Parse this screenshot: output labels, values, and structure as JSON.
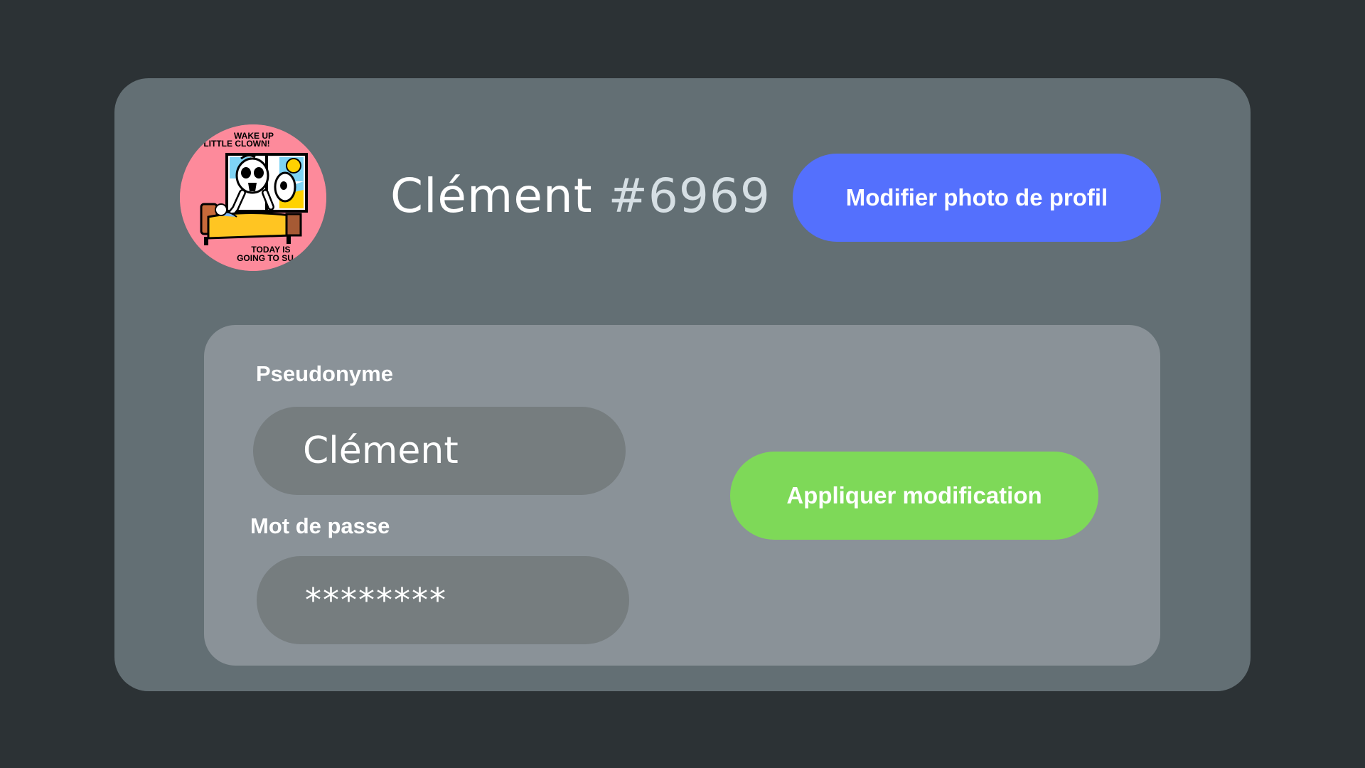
{
  "profile": {
    "name": "Clément",
    "tag": "#6969",
    "avatar": {
      "icon": "avatar-illustration",
      "background_color": "#fd8a9b",
      "text_top_line1": "WAKE UP",
      "text_top_line2": "LITTLE CLOWN!",
      "text_bottom_line1": "TODAY IS",
      "text_bottom_line2": "GOING TO SU"
    }
  },
  "buttons": {
    "change_photo_label": "Modifier photo de profil",
    "apply_label": "Appliquer modification"
  },
  "form": {
    "username_label": "Pseudonyme",
    "username_value": "Clément",
    "password_label": "Mot de passe",
    "password_value": "********"
  },
  "colors": {
    "page_background": "#2c3235",
    "card_background": "#636f74",
    "panel_background": "#8a9298",
    "field_background": "#767d7f",
    "primary_button": "#5470fd",
    "apply_button": "#7ed958"
  }
}
